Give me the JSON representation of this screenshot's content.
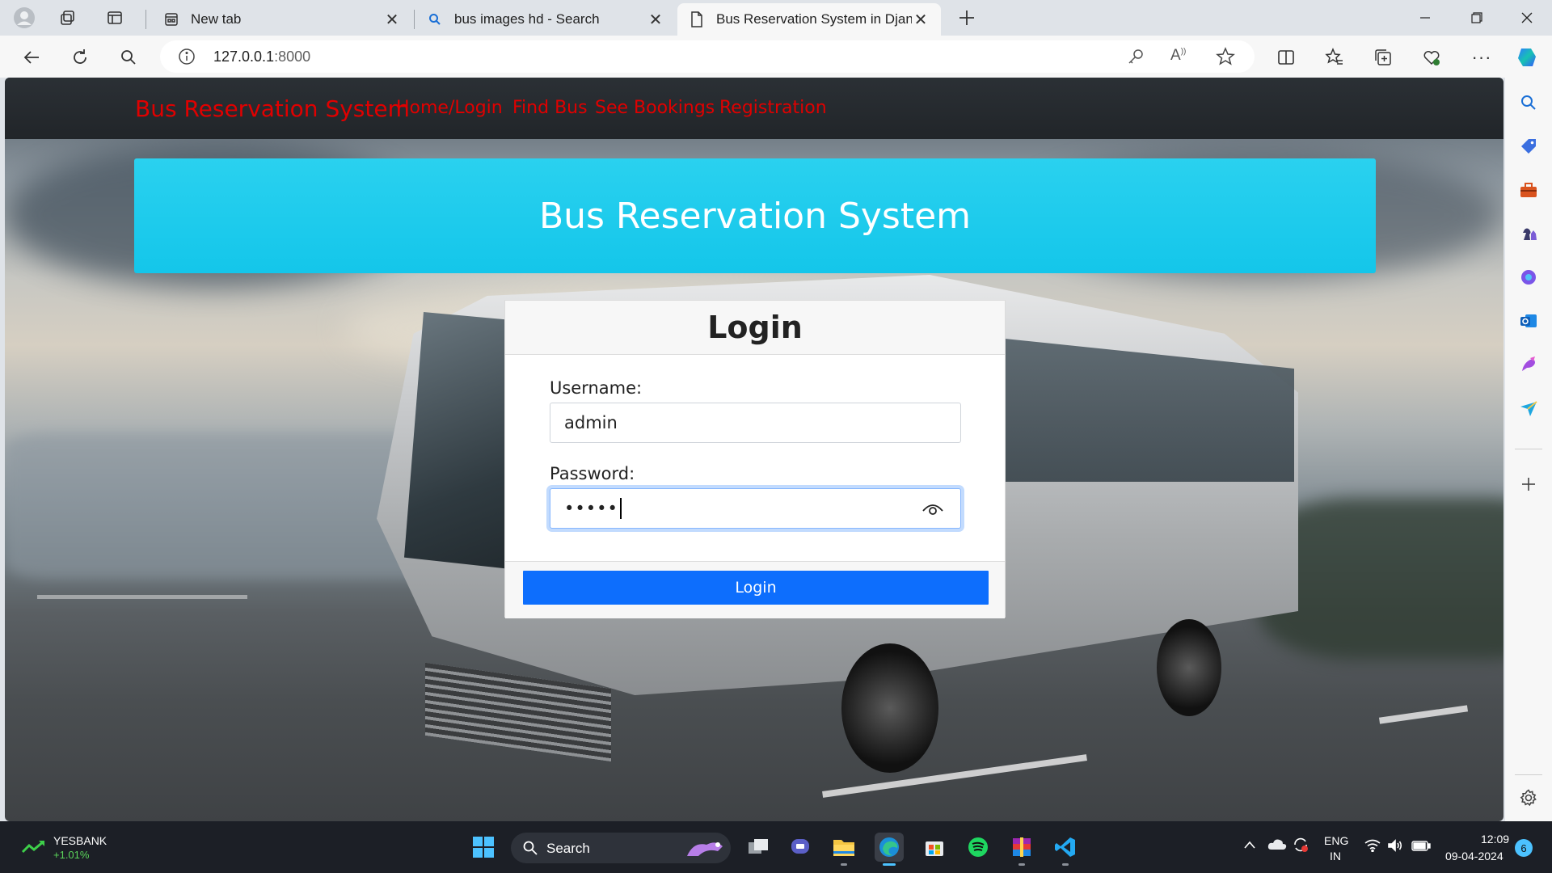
{
  "browser": {
    "tabs": [
      {
        "title": "New tab"
      },
      {
        "title": "bus images hd - Search"
      },
      {
        "title": "Bus Reservation System in Djang"
      }
    ],
    "url_host": "127.0.0.1",
    "url_port": ":8000"
  },
  "site": {
    "brand": "Bus Reservation System",
    "nav": [
      "Home/Login",
      "Find Bus",
      "See Bookings",
      "Registration"
    ],
    "banner_title": "Bus Reservation System",
    "colors": {
      "nav_link": "#e00000",
      "banner": "#1ccbec",
      "primary_button": "#0d6efd",
      "navbar": "#212529"
    }
  },
  "login": {
    "title": "Login",
    "username_label": "Username:",
    "username_value": "admin",
    "password_label": "Password:",
    "password_value": "•••••",
    "submit_label": "Login"
  },
  "taskbar": {
    "stock_name": "YESBANK",
    "stock_change": "+1.01%",
    "search_label": "Search",
    "lang": "ENG",
    "region": "IN",
    "time": "12:09",
    "date": "09-04-2024",
    "notification_count": "6"
  },
  "icons": {
    "sidebar": [
      "search-icon",
      "tag-icon",
      "toolbox-icon",
      "chess-icon",
      "copilot-icon",
      "outlook-icon",
      "designer-icon",
      "send-icon",
      "add-icon",
      "settings-icon"
    ]
  }
}
